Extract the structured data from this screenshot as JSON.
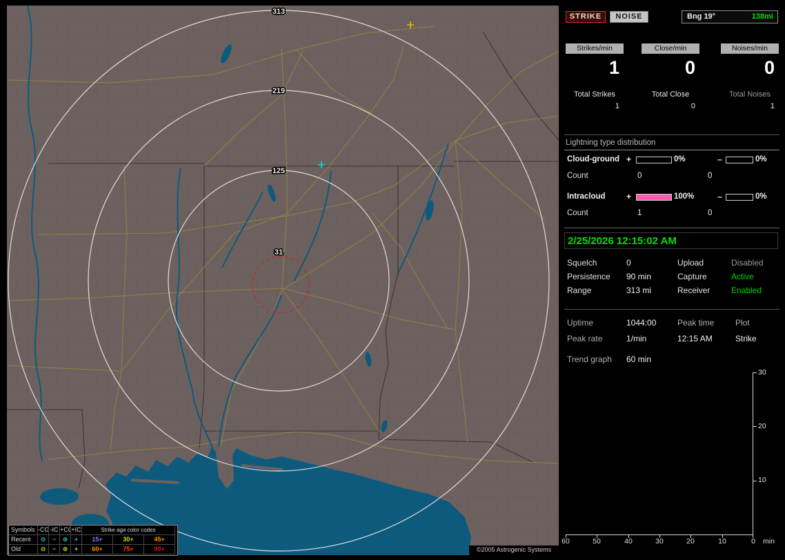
{
  "colors": {
    "accent_green": "#00e000",
    "intracloud_pink": "#ff5cb0",
    "strike_red": "#d83030",
    "map_land": "#6d615f",
    "map_water": "#0e5a7d",
    "road_yellow": "#96893c",
    "ring_white": "#dedede",
    "alarm_ring_red": "#cc2222"
  },
  "map": {
    "ring_labels": [
      "313",
      "219",
      "125",
      "31"
    ],
    "copyright": "©2005 Astrogenic Systems",
    "legend": {
      "symbols_header": "Symbols",
      "col_headers": [
        "-CG",
        "-IC",
        "+CG",
        "+IC"
      ],
      "age_header": "Strike age color codes",
      "glyphs": {
        "neg_cg": "⊖",
        "neg_ic": "−",
        "pos_cg": "⊕",
        "pos_ic": "+"
      },
      "rows": [
        {
          "label": "Recent",
          "ages": [
            "15+",
            "30+",
            "45+"
          ]
        },
        {
          "label": "Old",
          "ages": [
            "60+",
            "75+",
            "90+"
          ]
        }
      ]
    }
  },
  "panel": {
    "strike_button": "STRIKE",
    "noise_button": "NOISE",
    "bearing": "Bng 19°",
    "range_dist": "138mi",
    "rate_headers": [
      "Strikes/min",
      "Close/min",
      "Noises/min"
    ],
    "rate_values": [
      "1",
      "0",
      "0"
    ],
    "total_labels": [
      "Total Strikes",
      "Total Close",
      "Total Noises"
    ],
    "total_values": [
      "1",
      "0",
      "1"
    ],
    "distribution": {
      "title": "Lightning type distribution",
      "count_label": "Count",
      "plus": "+",
      "minus": "–",
      "rows": [
        {
          "label": "Cloud-ground",
          "plus_pct": "0%",
          "plus_fill": 0,
          "minus_pct": "0%",
          "minus_fill": 0,
          "count_plus": "0",
          "count_minus": "0"
        },
        {
          "label": "Intracloud",
          "plus_pct": "100%",
          "plus_fill": 100,
          "minus_pct": "0%",
          "minus_fill": 0,
          "count_plus": "1",
          "count_minus": "0"
        }
      ]
    },
    "datetime": "2/25/2026 12:15:02 AM",
    "status_rows": [
      {
        "l1": "Squelch",
        "v1": "0",
        "l2": "Upload",
        "v2": "Disabled"
      },
      {
        "l1": "Persistence",
        "v1": "90 min",
        "l2": "Capture",
        "v2": "Active"
      },
      {
        "l1": "Range",
        "v1": "313 mi",
        "l2": "Receiver",
        "v2": "Enabled"
      }
    ],
    "stats": {
      "uptime_label": "Uptime",
      "uptime": "1044:00",
      "peak_time_label": "Peak time",
      "plot_label": "Plot",
      "peak_rate_label": "Peak rate",
      "peak_rate": "1/min",
      "peak_time": "12:15 AM",
      "plot": "Strike",
      "trend_label": "Trend graph",
      "trend_value": "60 min"
    },
    "graph": {
      "y_ticks": [
        "30",
        "20",
        "10"
      ],
      "x_ticks": [
        "60",
        "50",
        "40",
        "30",
        "20",
        "10",
        "0"
      ],
      "unit": "min"
    }
  }
}
